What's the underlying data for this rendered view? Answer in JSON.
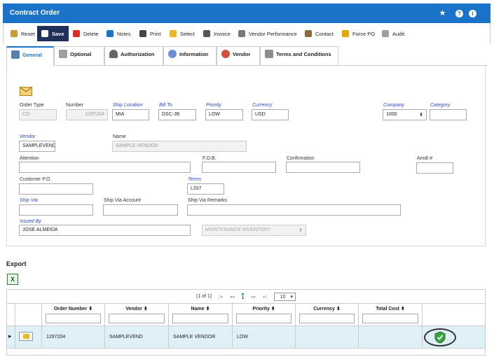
{
  "window": {
    "title": "Contract Order",
    "icons": [
      "star-icon",
      "help-icon",
      "info-icon"
    ]
  },
  "toolbar": [
    {
      "label": "Reset",
      "icon": "reset-icon",
      "color": "#c99a2e"
    },
    {
      "label": "Save",
      "icon": "save-icon",
      "color": "#ffffff",
      "active": true
    },
    {
      "label": "Delete",
      "icon": "delete-icon",
      "color": "#d93025"
    },
    {
      "label": "Notes",
      "icon": "notes-icon",
      "color": "#1a73c8"
    },
    {
      "label": "Print",
      "icon": "print-icon",
      "color": "#444444"
    },
    {
      "label": "Select",
      "icon": "select-icon",
      "color": "#e8b923"
    },
    {
      "label": "Invoice",
      "icon": "invoice-icon",
      "color": "#555555"
    },
    {
      "label": "Vendor Performance",
      "icon": "vendor-performance-icon",
      "color": "#777777"
    },
    {
      "label": "Contact",
      "icon": "contact-icon",
      "color": "#8a6d3b"
    },
    {
      "label": "Force PO",
      "icon": "force-po-icon",
      "color": "#e0a800"
    },
    {
      "label": "Audit",
      "icon": "audit-icon",
      "color": "#9aa0a6"
    }
  ],
  "tabs": [
    {
      "label": "General",
      "active": true
    },
    {
      "label": "Optional"
    },
    {
      "label": "Authorization"
    },
    {
      "label": "Information"
    },
    {
      "label": "Vendor"
    },
    {
      "label": "Terms and Conditions"
    }
  ],
  "form": {
    "order_type": {
      "label": "Order Type",
      "value": "CO"
    },
    "number": {
      "label": "Number",
      "value": "1297204"
    },
    "ship_location": {
      "label": "Ship Location",
      "value": "MIA"
    },
    "bill_to": {
      "label": "Bill To",
      "value": "DSC-JB"
    },
    "priority": {
      "label": "Priority",
      "value": "LOW"
    },
    "currency": {
      "label": "Currency",
      "value": "USD"
    },
    "company": {
      "label": "Company",
      "value": "1000"
    },
    "category": {
      "label": "Category",
      "value": ""
    },
    "vendor": {
      "label": "Vendor",
      "value": "SAMPLEVEND"
    },
    "name": {
      "label": "Name",
      "value": "SAMPLE VENDOR"
    },
    "attention": {
      "label": "Attention",
      "value": ""
    },
    "fob": {
      "label": "F.O.B.",
      "value": ""
    },
    "confirmation": {
      "label": "Confirmation",
      "value": ""
    },
    "amdt": {
      "label": "Amdt #",
      "value": ""
    },
    "customer_po": {
      "label": "Customer P.O.",
      "value": ""
    },
    "terms": {
      "label": "Terms",
      "value": "L337"
    },
    "ship_via": {
      "label": "Ship Via",
      "value": ""
    },
    "ship_via_account": {
      "label": "Ship Via Account",
      "value": ""
    },
    "ship_via_remarks": {
      "label": "Ship Via Remarks",
      "value": ""
    },
    "issued_by": {
      "label": "Issued By",
      "value": "JOSE ALMEIDA"
    },
    "inventory": {
      "value": "MAINTENANCE INVENTORY"
    }
  },
  "export": {
    "title": "Export",
    "excel_icon": "excel-export-icon",
    "excel_glyph": "X"
  },
  "grid": {
    "pager": {
      "info": "(1 of 1)",
      "page": "1",
      "page_size": "10"
    },
    "columns": [
      "Order Number",
      "Vendor",
      "Name",
      "Priority",
      "Currency",
      "Total Cost"
    ],
    "rows": [
      {
        "order_number": "1297204",
        "vendor": "SAMPLEVEND",
        "name": "SAMPLE VENDOR",
        "priority": "LOW",
        "currency": "",
        "total_cost": "",
        "status_icon": "shield-check-icon"
      }
    ]
  }
}
